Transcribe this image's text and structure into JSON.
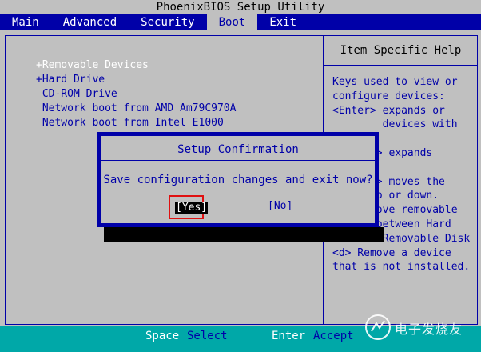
{
  "app": {
    "title": "PhoenixBIOS Setup Utility"
  },
  "menu": {
    "items": [
      {
        "label": "Main"
      },
      {
        "label": "Advanced"
      },
      {
        "label": "Security"
      },
      {
        "label": "Boot",
        "active": true
      },
      {
        "label": "Exit"
      }
    ]
  },
  "boot": {
    "items": [
      {
        "label": "+Removable Devices",
        "selected": true
      },
      {
        "label": "+Hard Drive"
      },
      {
        "label": " CD-ROM Drive"
      },
      {
        "label": " Network boot from AMD Am79C970A"
      },
      {
        "label": " Network boot from Intel E1000"
      }
    ]
  },
  "help": {
    "title": "Item Specific Help",
    "text": "Keys used to view or\nconfigure devices:\n<Enter> expands or\n        devices with\n\n     er> expands\n\n     <-> moves the\n       p or down.\n       ove removable\ndevice between Hard\nDisk or Removable Disk\n<d> Remove a device\nthat is not installed."
  },
  "dialog": {
    "title": "Setup Confirmation",
    "message": "Save configuration changes and exit now?",
    "yes_label": "[Yes]",
    "no_label": "[No]"
  },
  "footer": {
    "key1": "Space",
    "desc1": "Select",
    "key2": "Enter",
    "desc2": "Accept"
  },
  "watermark": {
    "text": "电子发烧友"
  },
  "colors": {
    "bios_blue": "#0000a8",
    "bios_gray": "#c0c0c0",
    "footer_cyan": "#00a8a8",
    "highlight_red": "#e01010"
  }
}
